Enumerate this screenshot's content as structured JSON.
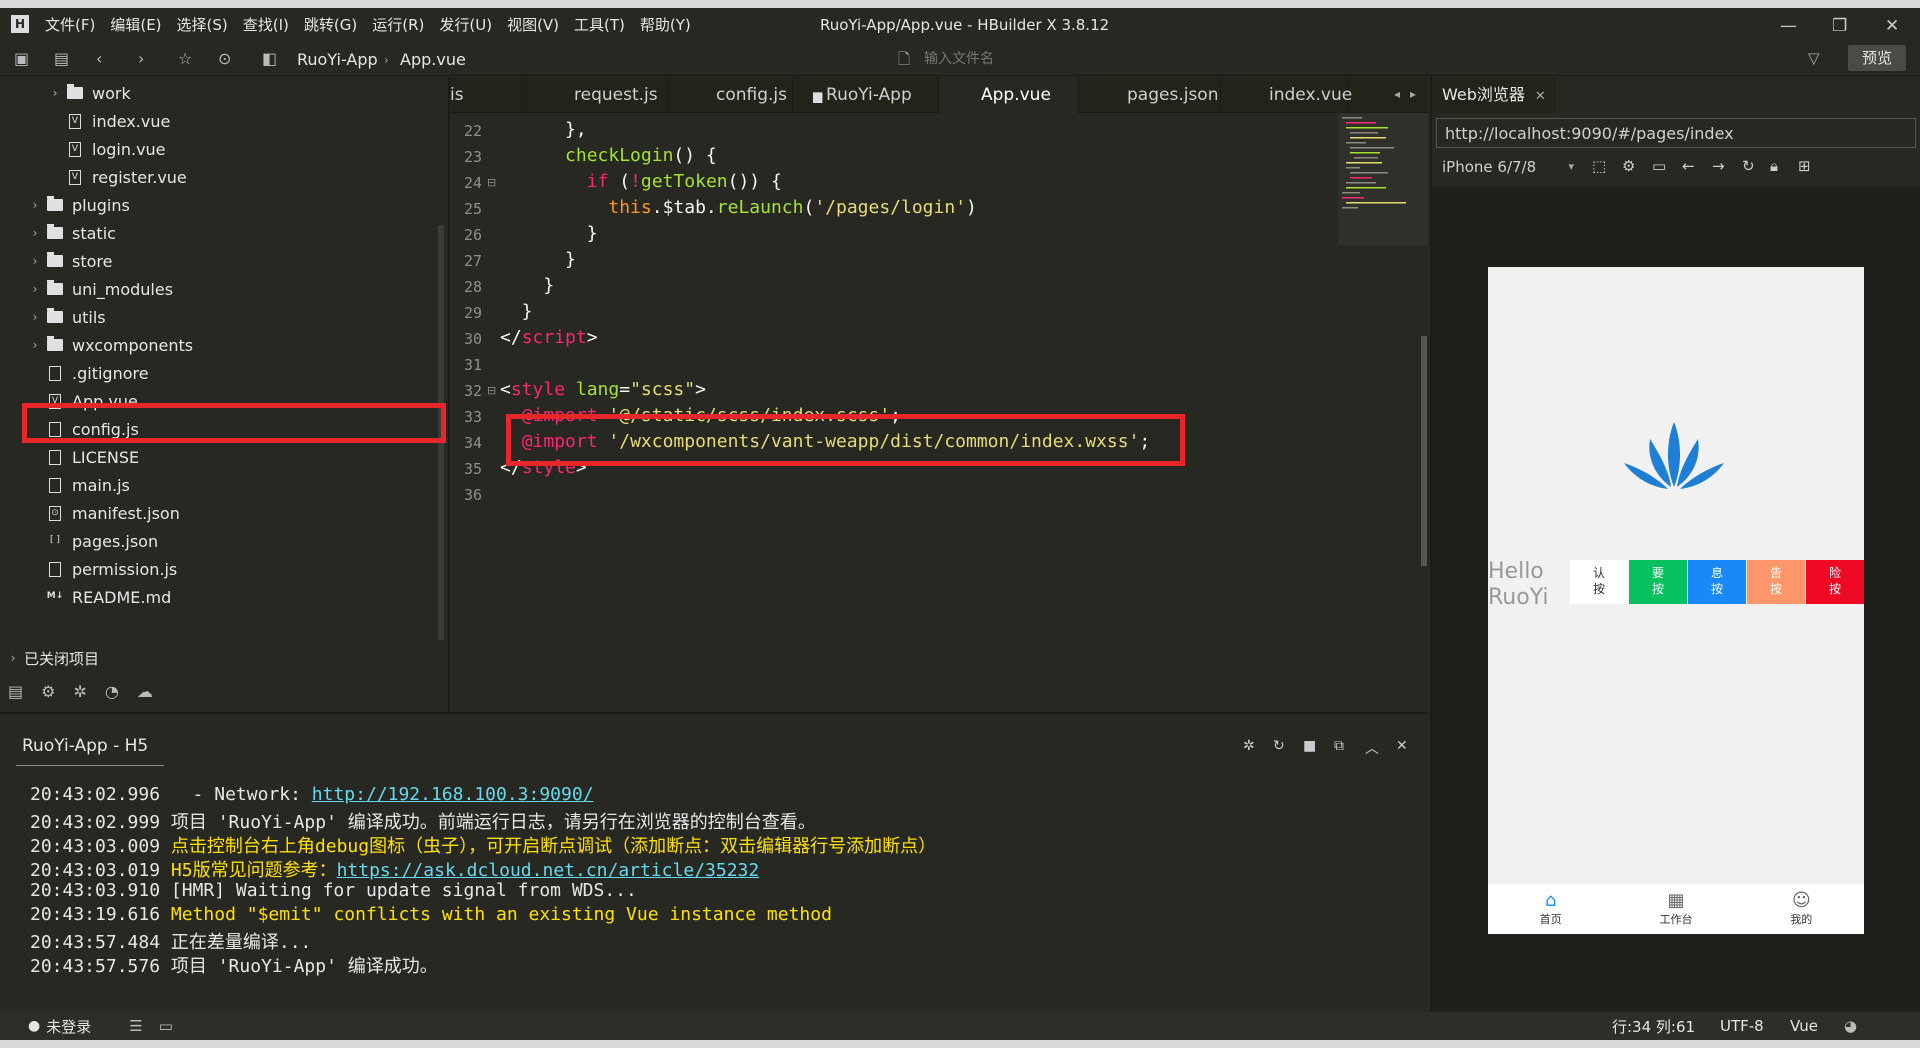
{
  "window": {
    "title": "RuoYi-App/App.vue - HBuilder X 3.8.12",
    "logo": "H",
    "controls": [
      "—",
      "❐",
      "✕"
    ]
  },
  "menu": [
    "文件(F)",
    "编辑(E)",
    "选择(S)",
    "查找(I)",
    "跳转(G)",
    "运行(R)",
    "发行(U)",
    "视图(V)",
    "工具(T)",
    "帮助(Y)"
  ],
  "toolbar": {
    "breadcrumb": [
      "RuoYi-App",
      "App.vue"
    ],
    "file_search_placeholder": "输入文件名",
    "preview_label": "预览"
  },
  "sidebar": {
    "items": [
      {
        "label": "work",
        "type": "folder",
        "expandable": true
      },
      {
        "label": "index.vue",
        "type": "vue"
      },
      {
        "label": "login.vue",
        "type": "vue"
      },
      {
        "label": "register.vue",
        "type": "vue"
      },
      {
        "label": "plugins",
        "type": "folder",
        "expandable": true
      },
      {
        "label": "static",
        "type": "folder",
        "expandable": true
      },
      {
        "label": "store",
        "type": "folder",
        "expandable": true
      },
      {
        "label": "uni_modules",
        "type": "folder",
        "expandable": true
      },
      {
        "label": "utils",
        "type": "folder",
        "expandable": true
      },
      {
        "label": "wxcomponents",
        "type": "folder",
        "expandable": true
      },
      {
        "label": ".gitignore",
        "type": "file"
      },
      {
        "label": "App.vue",
        "type": "vue",
        "highlighted": true
      },
      {
        "label": "config.js",
        "type": "file"
      },
      {
        "label": "LICENSE",
        "type": "file"
      },
      {
        "label": "main.js",
        "type": "file"
      },
      {
        "label": "manifest.json",
        "type": "manifest"
      },
      {
        "label": "pages.json",
        "type": "json"
      },
      {
        "label": "permission.js",
        "type": "file"
      },
      {
        "label": "README.md",
        "type": "md"
      }
    ],
    "closed_projects": "已关闭项目"
  },
  "tabs": [
    {
      "label": "is"
    },
    {
      "label": "request.js"
    },
    {
      "label": "config.js"
    },
    {
      "label": "RuoYi-App",
      "folder": true
    },
    {
      "label": "App.vue",
      "active": true
    },
    {
      "label": "pages.json"
    },
    {
      "label": "index.vue"
    }
  ],
  "editor": {
    "lines": [
      {
        "n": "22",
        "fold": false,
        "segments": [
          {
            "t": "      },",
            "c": ""
          }
        ]
      },
      {
        "n": "23",
        "fold": false,
        "segments": [
          {
            "t": "      ",
            "c": ""
          },
          {
            "t": "checkLogin",
            "c": "fn"
          },
          {
            "t": "() {",
            "c": ""
          }
        ]
      },
      {
        "n": "24",
        "fold": true,
        "segments": [
          {
            "t": "        ",
            "c": ""
          },
          {
            "t": "if",
            "c": "kw"
          },
          {
            "t": " (",
            "c": ""
          },
          {
            "t": "!",
            "c": "kw"
          },
          {
            "t": "getToken",
            "c": "fn"
          },
          {
            "t": "()) {",
            "c": ""
          }
        ]
      },
      {
        "n": "25",
        "fold": false,
        "segments": [
          {
            "t": "          ",
            "c": ""
          },
          {
            "t": "this",
            "c": "this"
          },
          {
            "t": ".$tab.",
            "c": ""
          },
          {
            "t": "reLaunch",
            "c": "fn"
          },
          {
            "t": "(",
            "c": ""
          },
          {
            "t": "'/pages/login'",
            "c": "str"
          },
          {
            "t": ")",
            "c": ""
          }
        ]
      },
      {
        "n": "26",
        "fold": false,
        "segments": [
          {
            "t": "        }",
            "c": ""
          }
        ]
      },
      {
        "n": "27",
        "fold": false,
        "segments": [
          {
            "t": "      }",
            "c": ""
          }
        ]
      },
      {
        "n": "28",
        "fold": false,
        "segments": [
          {
            "t": "    }",
            "c": ""
          }
        ]
      },
      {
        "n": "29",
        "fold": false,
        "segments": [
          {
            "t": "  }",
            "c": ""
          }
        ]
      },
      {
        "n": "30",
        "fold": false,
        "segments": [
          {
            "t": "</",
            "c": ""
          },
          {
            "t": "script",
            "c": "tag"
          },
          {
            "t": ">",
            "c": ""
          }
        ]
      },
      {
        "n": "31",
        "fold": false,
        "segments": []
      },
      {
        "n": "32",
        "fold": true,
        "segments": [
          {
            "t": "<",
            "c": ""
          },
          {
            "t": "style",
            "c": "tag"
          },
          {
            "t": " ",
            "c": ""
          },
          {
            "t": "lang",
            "c": "attr"
          },
          {
            "t": "=",
            "c": ""
          },
          {
            "t": "\"scss\"",
            "c": "str"
          },
          {
            "t": ">",
            "c": ""
          }
        ]
      },
      {
        "n": "33",
        "fold": false,
        "segments": [
          {
            "t": "  ",
            "c": ""
          },
          {
            "t": "@import",
            "c": "kw"
          },
          {
            "t": " ",
            "c": ""
          },
          {
            "t": "'@/static/scss/index.scss'",
            "c": "str"
          },
          {
            "t": ";",
            "c": ""
          }
        ]
      },
      {
        "n": "34",
        "fold": false,
        "segments": [
          {
            "t": "  ",
            "c": ""
          },
          {
            "t": "@import",
            "c": "kw"
          },
          {
            "t": " ",
            "c": ""
          },
          {
            "t": "'/wxcomponents/vant-weapp/dist/common/index.wxss'",
            "c": "str"
          },
          {
            "t": ";",
            "c": ""
          }
        ]
      },
      {
        "n": "35",
        "fold": false,
        "segments": [
          {
            "t": "</",
            "c": ""
          },
          {
            "t": "style",
            "c": "tag"
          },
          {
            "t": ">",
            "c": ""
          }
        ]
      },
      {
        "n": "36",
        "fold": false,
        "segments": []
      }
    ]
  },
  "browser": {
    "tab_label": "Web浏览器",
    "url": "http://localhost:9090/#/pages/index",
    "device": "iPhone 6/7/8",
    "page": {
      "hello": "Hello RuoYi",
      "buttons": [
        {
          "label": "认\n按",
          "bg": "#ffffff",
          "fg": "#333333"
        },
        {
          "label": "要\n按",
          "bg": "#07c160",
          "fg": "#ffffff"
        },
        {
          "label": "息\n按",
          "bg": "#1989fa",
          "fg": "#ffffff"
        },
        {
          "label": "告\n按",
          "bg": "#ff976a",
          "fg": "#ffffff"
        },
        {
          "label": "险\n按",
          "bg": "#ee0a24",
          "fg": "#ffffff"
        }
      ],
      "tabbar": [
        {
          "label": "首页",
          "icon": "home-icon",
          "active": true
        },
        {
          "label": "工作台",
          "icon": "grid-icon"
        },
        {
          "label": "我的",
          "icon": "user-icon"
        }
      ]
    }
  },
  "console": {
    "title": "RuoYi-App - H5",
    "lines": [
      {
        "segments": [
          {
            "t": "20:43:02.996   - Network: ",
            "c": ""
          },
          {
            "t": "http://192.168.100.3:9090/",
            "c": "link"
          }
        ]
      },
      {
        "segments": [
          {
            "t": "20:43:02.999 项目 'RuoYi-App' 编译成功。前端运行日志，请另行在浏览器的控制台查看。",
            "c": ""
          }
        ]
      },
      {
        "segments": [
          {
            "t": "20:43:03.009 ",
            "c": ""
          },
          {
            "t": "点击控制台右上角debug图标（虫子），可开启断点调试（添加断点：双击编辑器行号添加断点）",
            "c": "yellow"
          }
        ]
      },
      {
        "segments": [
          {
            "t": "20:43:03.019 ",
            "c": ""
          },
          {
            "t": "H5版常见问题参考：",
            "c": "yellow"
          },
          {
            "t": "https://ask.dcloud.net.cn/article/35232",
            "c": "link"
          }
        ]
      },
      {
        "segments": [
          {
            "t": "20:43:03.910 [HMR] Waiting for update signal from WDS...",
            "c": ""
          }
        ]
      },
      {
        "segments": [
          {
            "t": "20:43:19.616 ",
            "c": ""
          },
          {
            "t": "Method \"$emit\" conflicts with an existing Vue instance method",
            "c": "yellow"
          }
        ]
      },
      {
        "segments": [
          {
            "t": "20:43:57.484 正在差量编译...",
            "c": ""
          }
        ]
      },
      {
        "segments": [
          {
            "t": "20:43:57.576 项目 'RuoYi-App' 编译成功。",
            "c": ""
          }
        ]
      }
    ]
  },
  "statusbar": {
    "login": "未登录",
    "position": "行:34  列:61",
    "encoding": "UTF-8",
    "language": "Vue"
  },
  "colors": {
    "highlight_box": "#e5262b",
    "editor_bg": "#272822"
  }
}
